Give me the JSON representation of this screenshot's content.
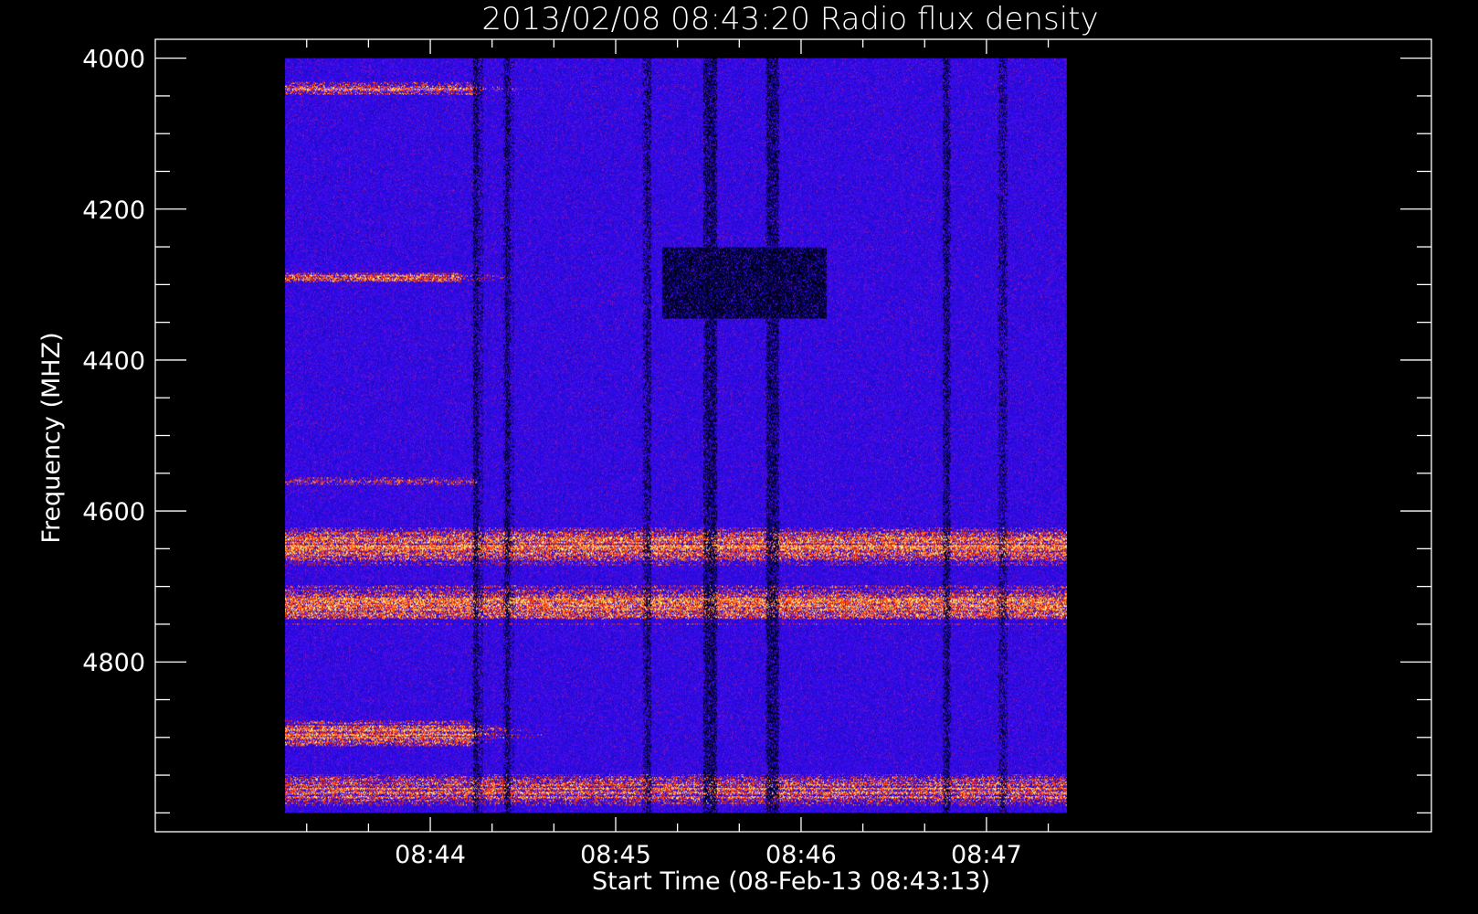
{
  "chart_data": {
    "type": "heatmap",
    "title": "2013/02/08 08:43:20 Radio flux density",
    "xlabel": "Start Time (08-Feb-13 08:43:13)",
    "ylabel": "Frequency (MHZ)",
    "x_axis": {
      "range": [
        "08:43:13",
        "08:47:26"
      ],
      "major_ticks": [
        "08:44",
        "08:45",
        "08:46",
        "08:47"
      ],
      "minor_tick_interval_seconds": 20
    },
    "y_axis": {
      "unit": "MHZ",
      "range": [
        3975,
        5025
      ],
      "inverted": true,
      "major_ticks": [
        4000,
        4200,
        4400,
        4600,
        4800
      ],
      "minor_tick_interval": 50
    },
    "data_extent": {
      "time": [
        "08:43:13",
        "08:47:26"
      ],
      "frequency_mhz": [
        4000,
        5000
      ]
    },
    "colormap": {
      "low": "#000000",
      "mid": "#0000ff",
      "high": "#ff2a00",
      "peak": "#ffff66",
      "background": "#1010e8"
    },
    "bright_bands_mhz": [
      {
        "center": 4040,
        "width": 12,
        "strength": 0.85,
        "t_end": "08:44:15"
      },
      {
        "center": 4290,
        "width": 10,
        "strength": 0.85,
        "t_end": "08:44:10"
      },
      {
        "center": 4560,
        "width": 8,
        "strength": 0.6,
        "t_end": "08:44:15"
      },
      {
        "center": 4645,
        "width": 35,
        "strength": 0.9,
        "t_end": "08:47:26"
      },
      {
        "center": 4725,
        "width": 35,
        "strength": 0.9,
        "t_end": "08:47:26"
      },
      {
        "center": 4895,
        "width": 25,
        "strength": 0.9,
        "t_end": "08:44:15"
      },
      {
        "center": 4970,
        "width": 30,
        "strength": 0.85,
        "t_end": "08:47:26"
      }
    ],
    "dark_patches": [
      {
        "t": [
          "08:45:15",
          "08:46:08"
        ],
        "f": [
          4250,
          4345
        ]
      }
    ],
    "dark_streak_times": [
      "08:44:15",
      "08:44:25",
      "08:45:10",
      "08:45:30",
      "08:45:31",
      "08:45:50",
      "08:45:51",
      "08:46:47",
      "08:47:05"
    ]
  }
}
